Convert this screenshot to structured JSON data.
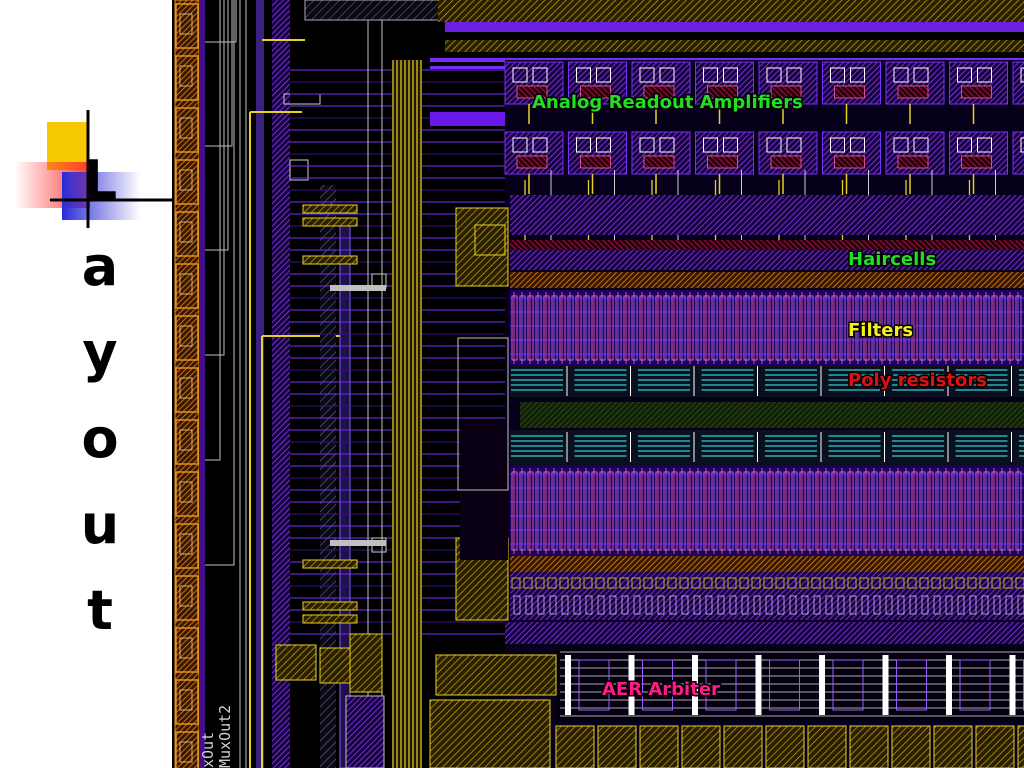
{
  "slide": {
    "title_letters": [
      "L",
      "a",
      "y",
      "o",
      "u",
      "t"
    ]
  },
  "chip": {
    "labels": {
      "amplifiers": "Analog Readout Amplifiers",
      "haircells": "Haircells",
      "filters": "Filters",
      "poly": "Poly resistors",
      "arbiter": "AER Arbiter"
    },
    "side_text": [
      "xOut",
      "MuxOut2"
    ],
    "colors": {
      "background": "#000000",
      "amplifiers_label": "#22dd22",
      "haircells_label": "#22dd22",
      "filters_label": "#f0f020",
      "poly_label": "#e01010",
      "arbiter_label": "#ff1a8c",
      "metal_purple": "#7a2cff",
      "metal_yellow": "#e8d020",
      "resistor_cyan": "#30d0d0",
      "pad_orange": "#e89020",
      "poly_red": "#d02020"
    }
  }
}
